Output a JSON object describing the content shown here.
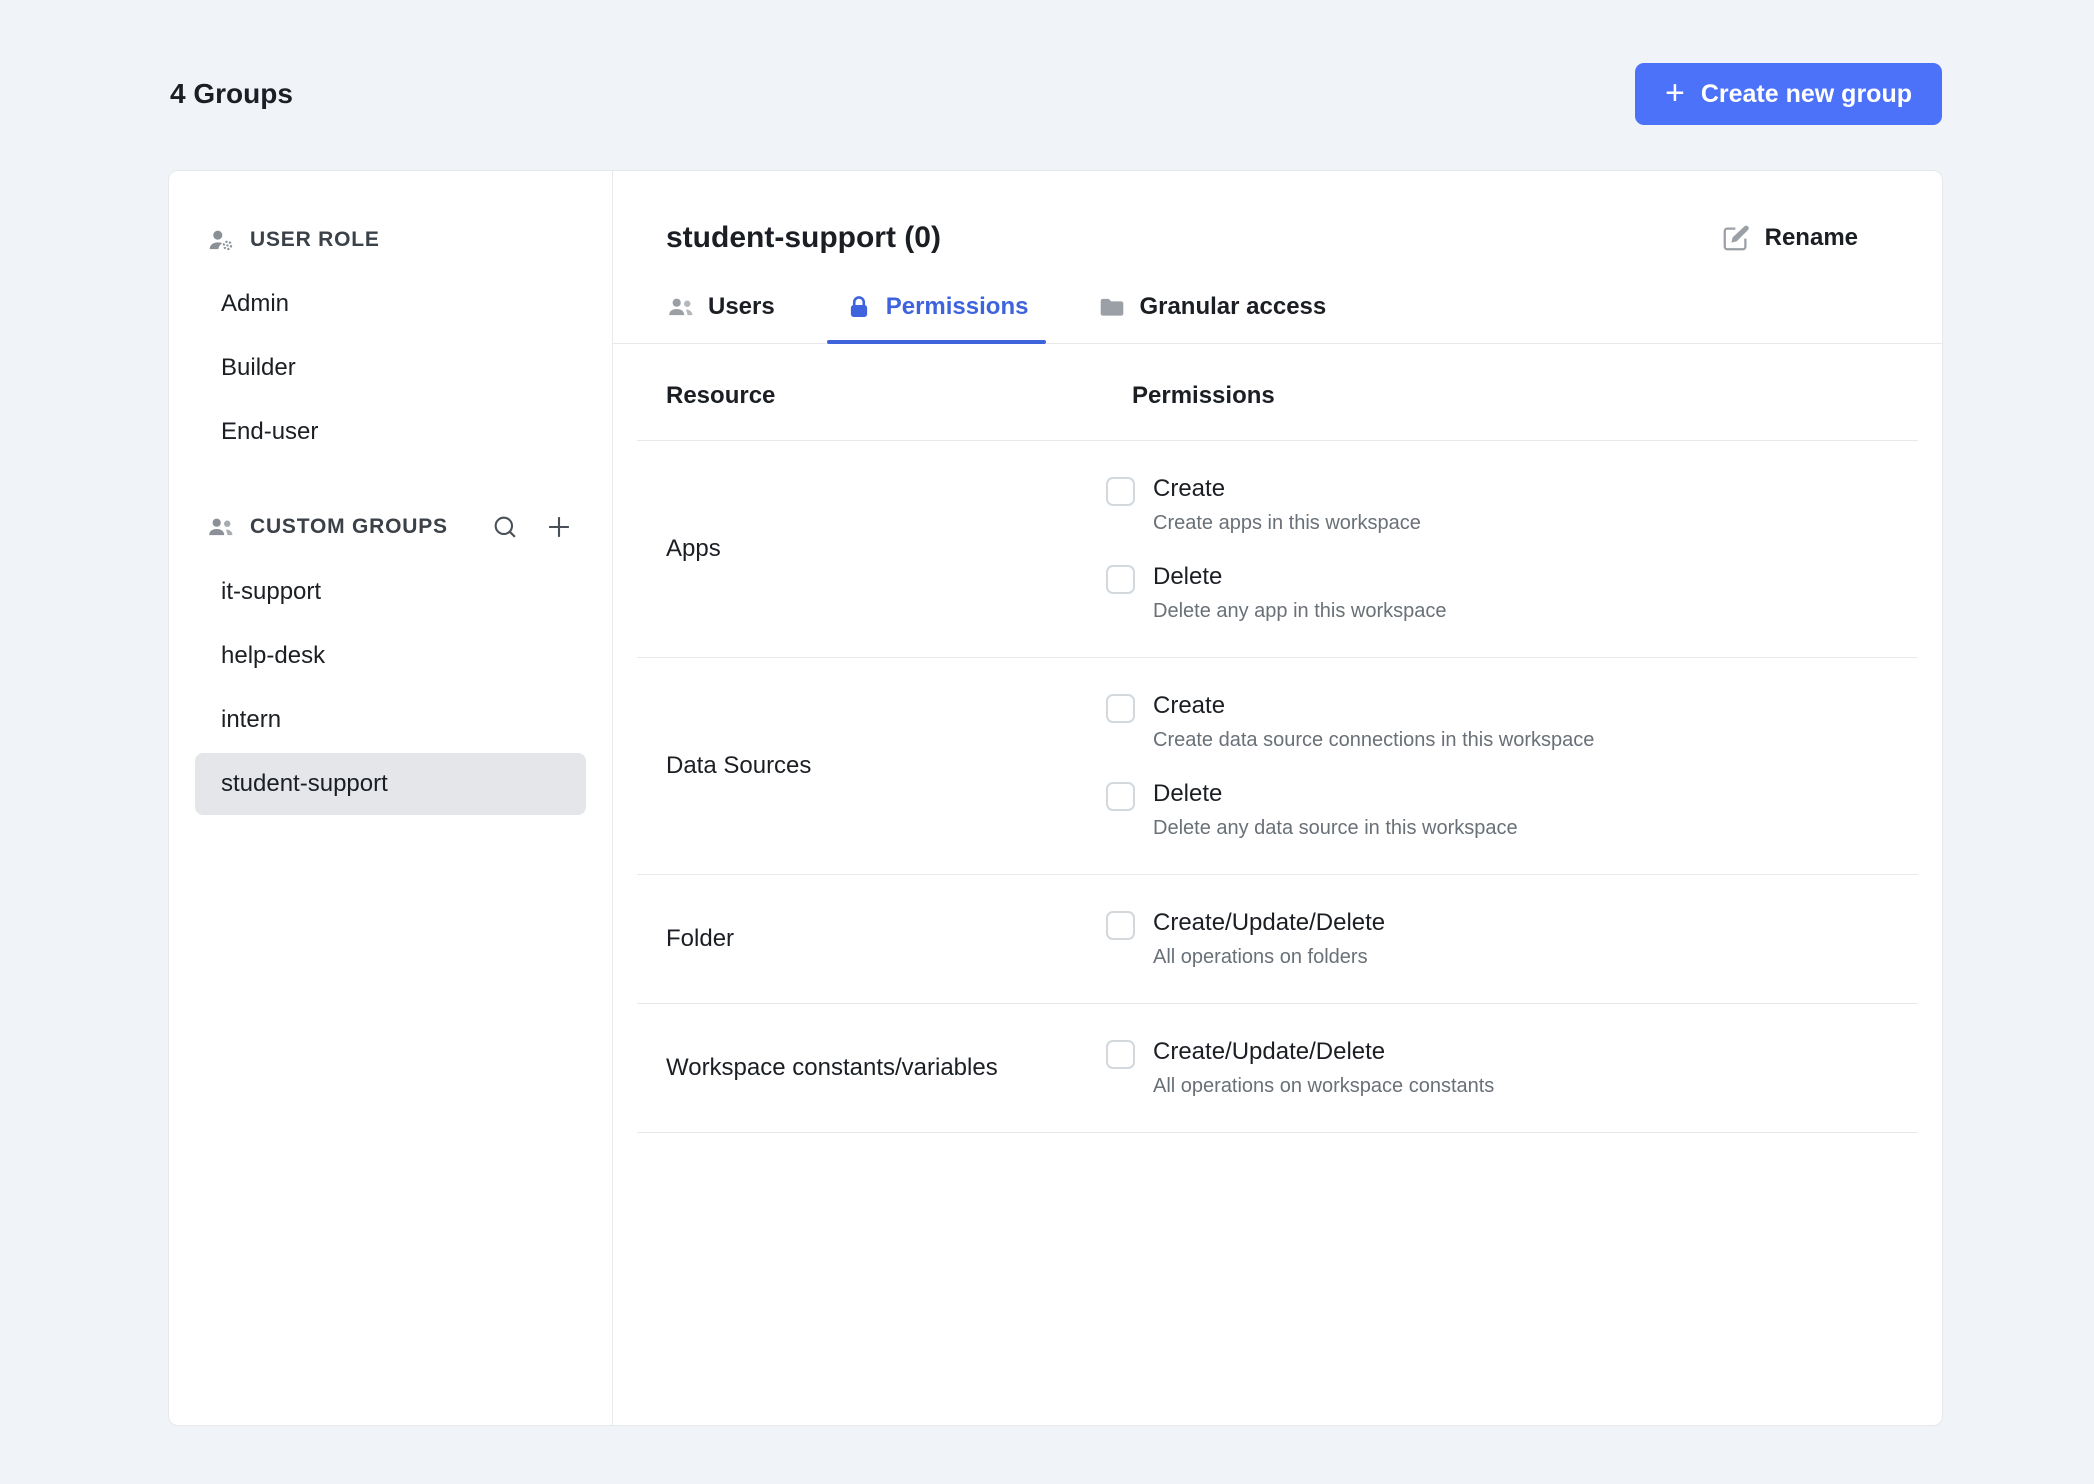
{
  "header": {
    "groups_count_label": "4 Groups",
    "create_group_button": "Create new group",
    "plus_glyph": "+"
  },
  "sidebar": {
    "user_role": {
      "label": "USER ROLE",
      "items": [
        {
          "label": "Admin",
          "selected": false
        },
        {
          "label": "Builder",
          "selected": false
        },
        {
          "label": "End-user",
          "selected": false
        }
      ]
    },
    "custom_groups": {
      "label": "CUSTOM GROUPS",
      "icons": [
        "search-icon",
        "plus-icon"
      ],
      "items": [
        {
          "label": "it-support",
          "selected": false
        },
        {
          "label": "help-desk",
          "selected": false
        },
        {
          "label": "intern",
          "selected": false
        },
        {
          "label": "student-support",
          "selected": true
        }
      ]
    }
  },
  "main": {
    "title": "student-support (0)",
    "rename_button": "Rename",
    "tabs": [
      {
        "label": "Users",
        "icon": "users-icon",
        "active": false
      },
      {
        "label": "Permissions",
        "icon": "lock-icon",
        "active": true
      },
      {
        "label": "Granular access",
        "icon": "folder-icon",
        "active": false
      }
    ],
    "table": {
      "headers": {
        "resource": "Resource",
        "permissions": "Permissions"
      },
      "rows": [
        {
          "resource": "Apps",
          "permissions": [
            {
              "label": "Create",
              "description": "Create apps in this workspace",
              "checked": false
            },
            {
              "label": "Delete",
              "description": "Delete any app in this workspace",
              "checked": false
            }
          ]
        },
        {
          "resource": "Data Sources",
          "permissions": [
            {
              "label": "Create",
              "description": "Create data source connections in this workspace",
              "checked": false
            },
            {
              "label": "Delete",
              "description": "Delete any data source in this workspace",
              "checked": false
            }
          ]
        },
        {
          "resource": "Folder",
          "permissions": [
            {
              "label": "Create/Update/Delete",
              "description": "All operations on folders",
              "checked": false
            }
          ]
        },
        {
          "resource": "Workspace constants/variables",
          "permissions": [
            {
              "label": "Create/Update/Delete",
              "description": "All operations on workspace constants",
              "checked": false
            }
          ]
        }
      ]
    }
  },
  "colors": {
    "primary_button": "#4d72fa",
    "tab_active": "#3e63dd",
    "page_background": "#f0f4f9",
    "card_background": "#ffffff",
    "selected_item_background": "#e4e6e9",
    "border": "#e7e9ec",
    "text_primary": "#1b1f24",
    "text_secondary": "#697077"
  }
}
